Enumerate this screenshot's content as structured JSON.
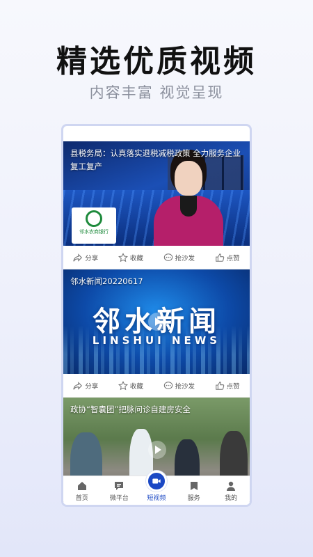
{
  "promo": {
    "headline": "精选优质视频",
    "subline": "内容丰富 视觉呈现"
  },
  "feed": {
    "cards": [
      {
        "title": "县税务局：认真落实退税减税政策 全力服务企业复工复产",
        "logo_text": "邻水农商银行"
      },
      {
        "title": "邻水新闻20220617",
        "program_cn": "邻水新闻",
        "program_en": "LINSHUI NEWS"
      },
      {
        "title": "政协“智囊团”把脉问诊自建房安全"
      }
    ],
    "actions": {
      "share": "分享",
      "favorite": "收藏",
      "comment": "抢沙发",
      "like": "点赞"
    }
  },
  "tabbar": {
    "items": [
      {
        "label": "首页",
        "icon": "home-icon"
      },
      {
        "label": "微平台",
        "icon": "chat-icon"
      },
      {
        "label": "短视频",
        "icon": "video-icon",
        "active": true
      },
      {
        "label": "服务",
        "icon": "bookmark-icon"
      },
      {
        "label": "我的",
        "icon": "user-icon"
      }
    ]
  },
  "colors": {
    "accent": "#1b48c4",
    "frame": "#cfd6f1"
  }
}
